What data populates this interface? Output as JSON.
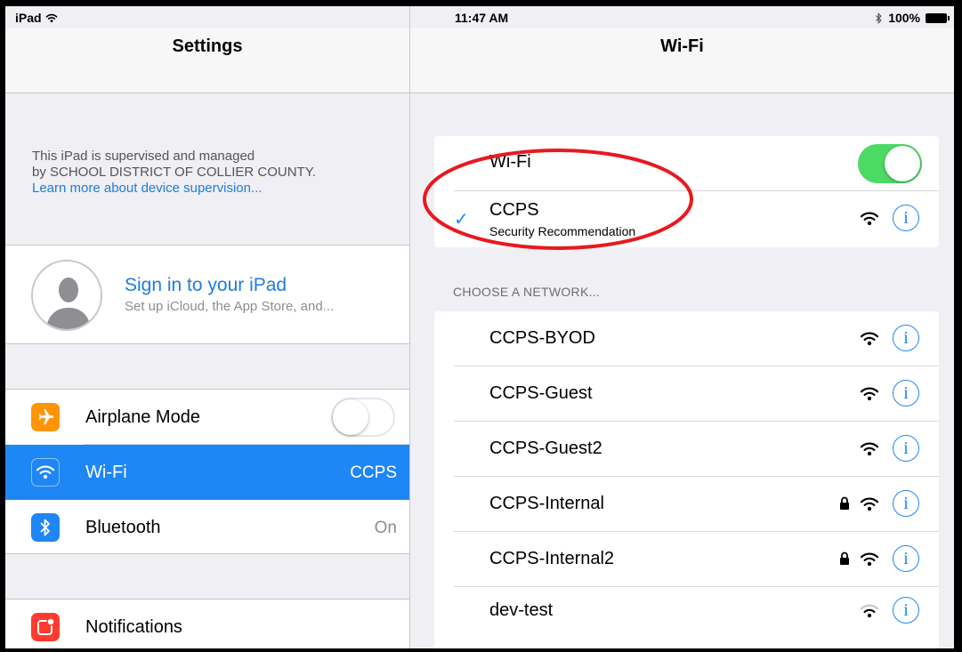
{
  "status_bar": {
    "device": "iPad",
    "time": "11:47 AM",
    "battery": "100%"
  },
  "left_panel": {
    "title": "Settings",
    "supervision": {
      "line1": "This iPad is supervised and managed",
      "line2": "by SCHOOL DISTRICT OF COLLIER COUNTY.",
      "link": "Learn more about device supervision..."
    },
    "signin": {
      "title": "Sign in to your iPad",
      "subtitle": "Set up iCloud, the App Store, and..."
    },
    "items": [
      {
        "label": "Airplane Mode",
        "value": "",
        "icon": "airplane-icon",
        "color": "#ff9500",
        "toggle": "off"
      },
      {
        "label": "Wi-Fi",
        "value": "CCPS",
        "icon": "wifi-icon",
        "color": "#1f86f6",
        "selected": true
      },
      {
        "label": "Bluetooth",
        "value": "On",
        "icon": "bluetooth-icon",
        "color": "#1f86f6"
      },
      {
        "label": "Notifications",
        "value": "",
        "icon": "notifications-icon",
        "color": "#ff3b30"
      }
    ]
  },
  "right_panel": {
    "title": "Wi-Fi",
    "wifi_toggle": {
      "label": "Wi-Fi",
      "state": "on"
    },
    "connected": {
      "name": "CCPS",
      "subtitle": "Security Recommendation"
    },
    "section_header": "CHOOSE A NETWORK...",
    "networks": [
      {
        "name": "CCPS-BYOD",
        "locked": false
      },
      {
        "name": "CCPS-Guest",
        "locked": false
      },
      {
        "name": "CCPS-Guest2",
        "locked": false
      },
      {
        "name": "CCPS-Internal",
        "locked": true
      },
      {
        "name": "CCPS-Internal2",
        "locked": true
      },
      {
        "name": "dev-test",
        "locked": false
      }
    ],
    "info_glyph": "i"
  },
  "colors": {
    "accent": "#1f86f6",
    "toggle_on": "#4cd964",
    "annotation": "#e8191f"
  }
}
